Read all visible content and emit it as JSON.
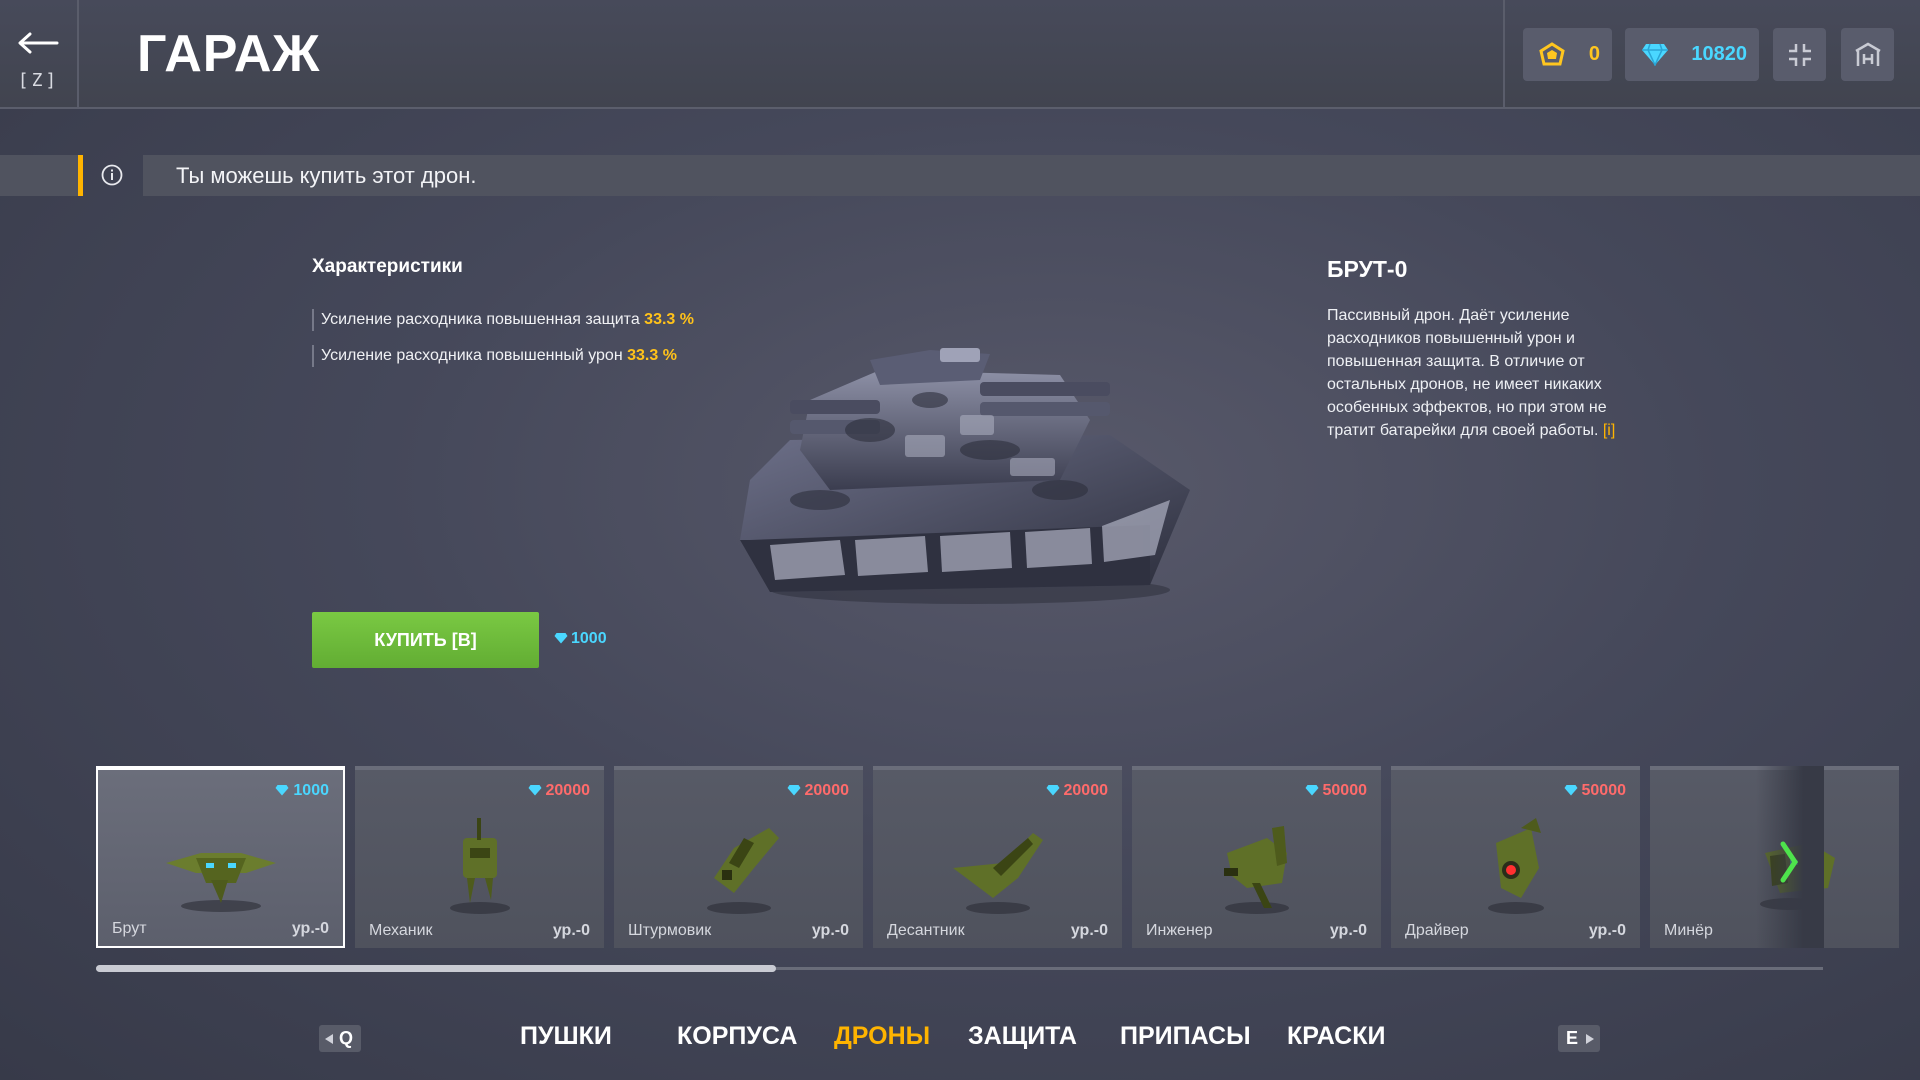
{
  "header": {
    "back_key": "[Z]",
    "title": "ГАРАЖ",
    "gold_icon": "crystal-badge-icon",
    "gold": "0",
    "gems_icon": "diamond-icon",
    "gems": "10820"
  },
  "banner": {
    "icon": "info-icon",
    "text": "Ты можешь купить этот дрон."
  },
  "stats": {
    "title": "Характеристики",
    "items": [
      {
        "label": "Усиление расходника повышенная защита",
        "value": "33.3 %"
      },
      {
        "label": "Усиление расходника повышенный урон",
        "value": "33.3 %"
      }
    ]
  },
  "buy": {
    "label": "КУПИТЬ [B]",
    "price": "1000"
  },
  "item": {
    "name": "БРУТ-0",
    "description": "Пассивный дрон. Даёт усиление расходников повышенный урон и повышенная защита. В отличие от остальных дронов, не имеет никаких особенных эффектов, но при этом не тратит батарейки для своей работы.",
    "link": "[i]"
  },
  "drones": [
    {
      "name": "Брут",
      "level": "ур.-0",
      "price": "1000",
      "price_color": "#4ad7ff",
      "selected": true
    },
    {
      "name": "Механик",
      "level": "ур.-0",
      "price": "20000",
      "price_color": "#ff6b6b"
    },
    {
      "name": "Штурмовик",
      "level": "ур.-0",
      "price": "20000",
      "price_color": "#ff6b6b"
    },
    {
      "name": "Десантник",
      "level": "ур.-0",
      "price": "20000",
      "price_color": "#ff6b6b"
    },
    {
      "name": "Инженер",
      "level": "ур.-0",
      "price": "50000",
      "price_color": "#ff6b6b"
    },
    {
      "name": "Драйвер",
      "level": "ур.-0",
      "price": "50000",
      "price_color": "#ff6b6b"
    },
    {
      "name": "Минёр",
      "level": "",
      "price": "",
      "price_color": "#ff6b6b"
    }
  ],
  "nav": {
    "prev_key": "Q",
    "next_key": "E",
    "tabs": [
      {
        "label": "ПУШКИ"
      },
      {
        "label": "КОРПУСА"
      },
      {
        "label": "ДРОНЫ",
        "active": true
      },
      {
        "label": "ЗАЩИТА"
      },
      {
        "label": "ПРИПАСЫ"
      },
      {
        "label": "КРАСКИ"
      }
    ]
  },
  "colors": {
    "accent": "#ffb400",
    "buy_green": "#6fbb3a",
    "gem_blue": "#4ad7ff",
    "price_red": "#ff6b6b"
  }
}
